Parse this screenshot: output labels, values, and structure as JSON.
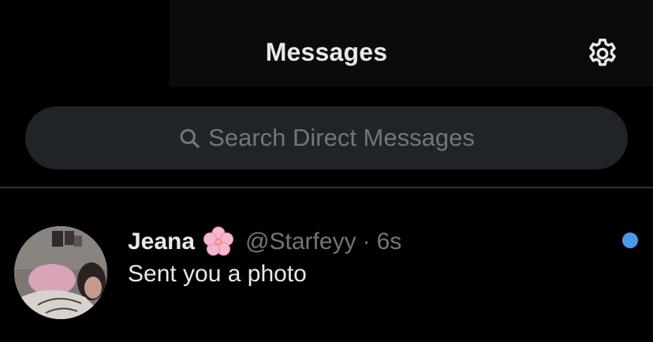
{
  "header": {
    "title": "Messages",
    "settings_icon": "gear-icon"
  },
  "search": {
    "placeholder": "Search Direct Messages",
    "icon": "search-icon"
  },
  "conversations": [
    {
      "display_name": "Jeana",
      "name_emoji": "cherry-blossom-icon",
      "handle": "@Starfeyy",
      "separator": "·",
      "time": "6s",
      "preview": "Sent you a photo",
      "unread": true
    }
  ],
  "colors": {
    "background": "#000000",
    "header_background": "#0b0b0c",
    "search_background": "#202327",
    "primary_text": "#e7e9ea",
    "secondary_text": "#71767b",
    "divider": "#2f3336",
    "unread_dot": "#4a99e9"
  }
}
